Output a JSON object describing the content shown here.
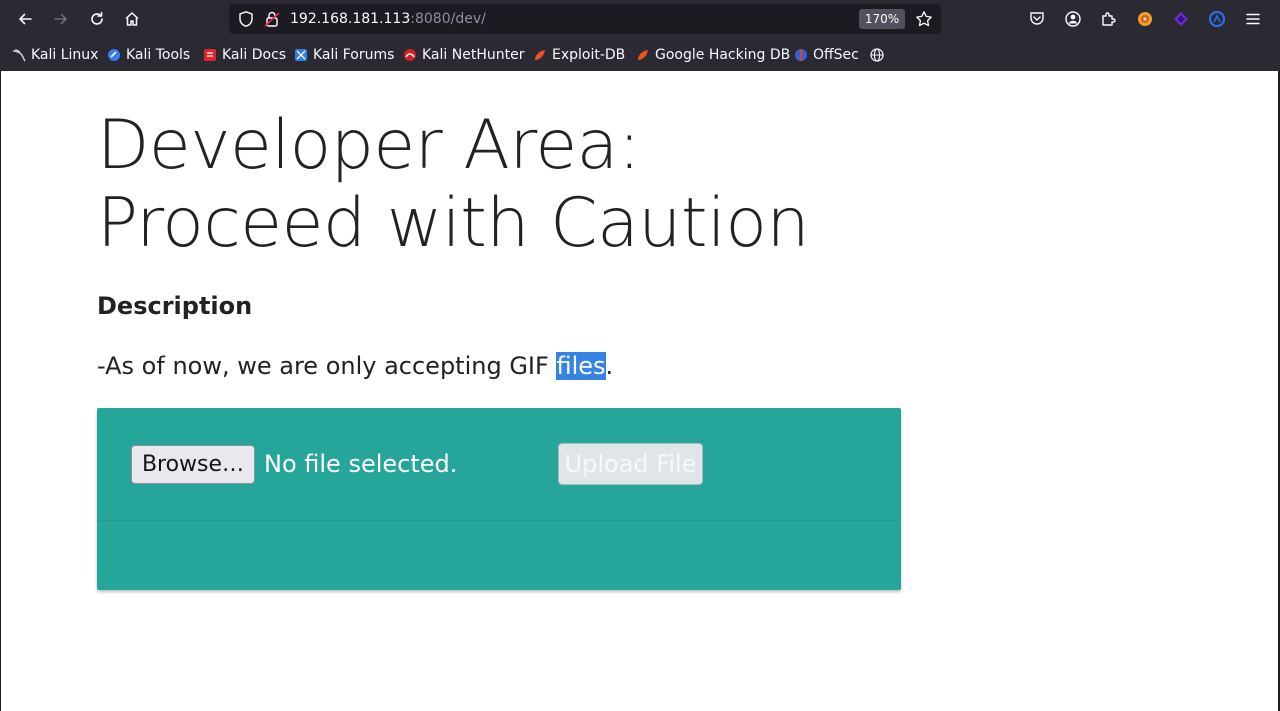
{
  "browser": {
    "url_host": "192.168.181.113",
    "url_path": ":8080/dev/",
    "zoom": "170%"
  },
  "bookmarks": [
    {
      "label": "Kali Linux",
      "icon": "kali-dragon-icon",
      "color": "#c0c0c0"
    },
    {
      "label": "Kali Tools",
      "icon": "kali-tools-icon",
      "color": "#367bf0"
    },
    {
      "label": "Kali Docs",
      "icon": "kali-docs-icon",
      "color": "#e0252b"
    },
    {
      "label": "Kali Forums",
      "icon": "kali-forums-icon",
      "color": "#2f7fe0"
    },
    {
      "label": "Kali NetHunter",
      "icon": "kali-nethunter-icon",
      "color": "#d02020"
    },
    {
      "label": "Exploit-DB",
      "icon": "exploit-db-icon",
      "color": "#e8541c"
    },
    {
      "label": "Google Hacking DB",
      "icon": "ghdb-icon",
      "color": "#e8541c"
    },
    {
      "label": "OffSec",
      "icon": "offsec-icon",
      "color": "#3a5fd0"
    }
  ],
  "page": {
    "title_line1": "Developer Area:",
    "title_line2": "Proceed with Caution",
    "description_heading": "Description",
    "description_text_before": "-As of now, we are only accepting GIF ",
    "description_text_selected": "files",
    "description_text_after": ".",
    "browse_label": "Browse…",
    "file_status": "No file selected.",
    "upload_label": "Upload File"
  },
  "colors": {
    "chrome": "#2b2a33",
    "urlbar": "#1c1b22",
    "card": "#26a69a",
    "selection": "#3584e4"
  }
}
